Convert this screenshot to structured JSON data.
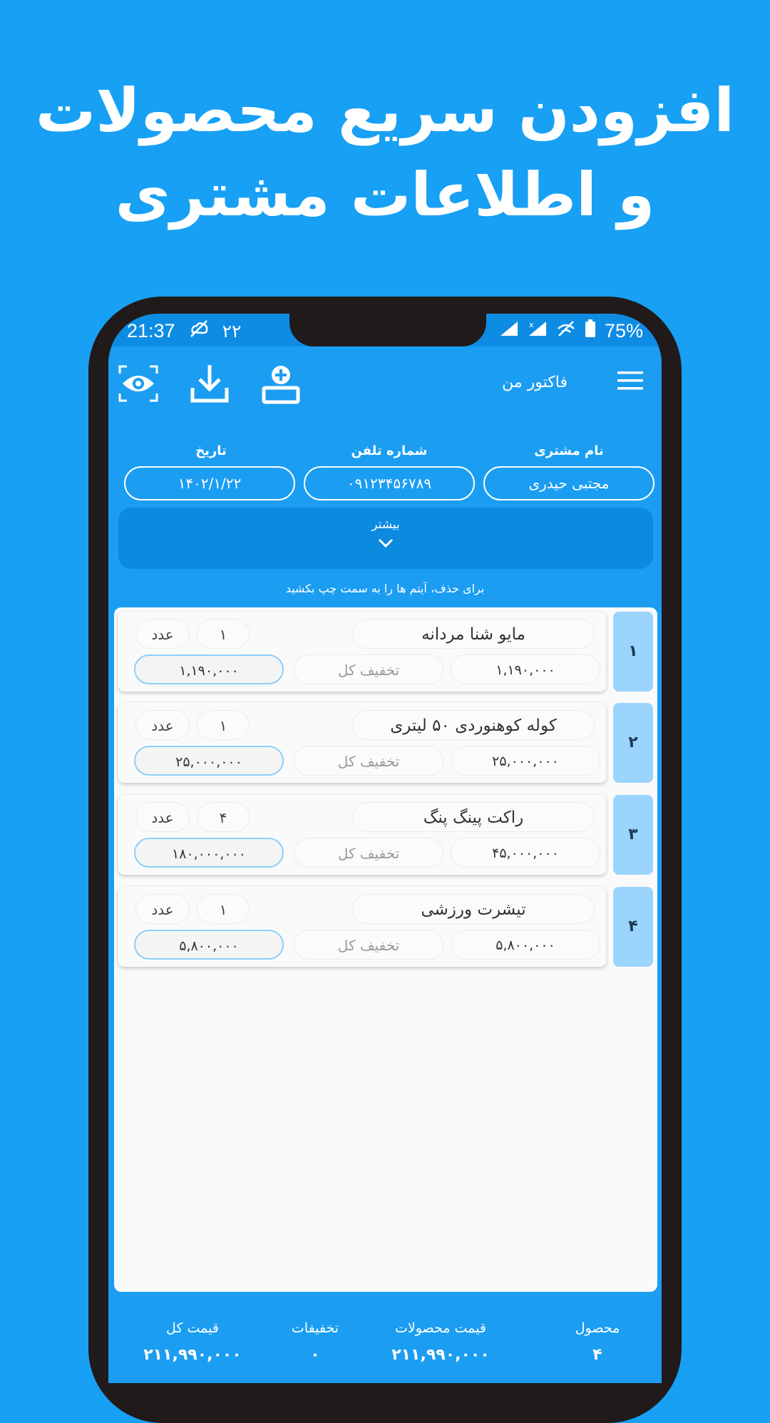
{
  "headline": {
    "line1": "افزودن سریع محصولات",
    "line2": "و اطلاعات مشتری"
  },
  "status_bar": {
    "time": "21:37",
    "temp": "۲۲",
    "battery": "75%"
  },
  "app_bar": {
    "title": "فاکتور من",
    "icons": [
      "menu-icon",
      "add-person-icon",
      "download-icon",
      "preview-eye-icon"
    ]
  },
  "customer": {
    "name_label": "نام مشتری",
    "name_value": "مجتبی حیدری",
    "phone_label": "شماره تلفن",
    "phone_value": "۰۹۱۲۳۴۵۶۷۸۹",
    "date_label": "تاریخ",
    "date_value": "۱۴۰۲/۱/۲۲"
  },
  "more": {
    "label": "بیشتر"
  },
  "hint": "برای حذف، آیتم ها را به سمت چپ بکشید",
  "items": [
    {
      "index": "۱",
      "name": "مایو شنا مردانه",
      "qty": "۱",
      "unit": "عدد",
      "price": "۱,۱۹۰,۰۰۰",
      "discount": "تخفیف کل",
      "total": "۱,۱۹۰,۰۰۰"
    },
    {
      "index": "۲",
      "name": "کوله کوهنوردی ۵۰ لیتری",
      "qty": "۱",
      "unit": "عدد",
      "price": "۲۵,۰۰۰,۰۰۰",
      "discount": "تخفیف کل",
      "total": "۲۵,۰۰۰,۰۰۰"
    },
    {
      "index": "۳",
      "name": "راکت پینگ پنگ",
      "qty": "۴",
      "unit": "عدد",
      "price": "۴۵,۰۰۰,۰۰۰",
      "discount": "تخفیف کل",
      "total": "۱۸۰,۰۰۰,۰۰۰"
    },
    {
      "index": "۴",
      "name": "تیشرت ورزشی",
      "qty": "۱",
      "unit": "عدد",
      "price": "۵,۸۰۰,۰۰۰",
      "discount": "تخفیف کل",
      "total": "۵,۸۰۰,۰۰۰"
    }
  ],
  "footer": {
    "products_label": "محصول",
    "products_value": "۴",
    "subtotal_label": "قیمت محصولات",
    "subtotal_value": "۲۱۱,۹۹۰,۰۰۰",
    "discounts_label": "تخفیفات",
    "discounts_value": "۰",
    "grand_total_label": "قیمت کل",
    "grand_total_value": "۲۱۱,۹۹۰,۰۰۰"
  },
  "colors": {
    "brand_blue": "#17a0f4",
    "index_tab": "#9bd4fc",
    "total_border": "#8cd0fb"
  }
}
